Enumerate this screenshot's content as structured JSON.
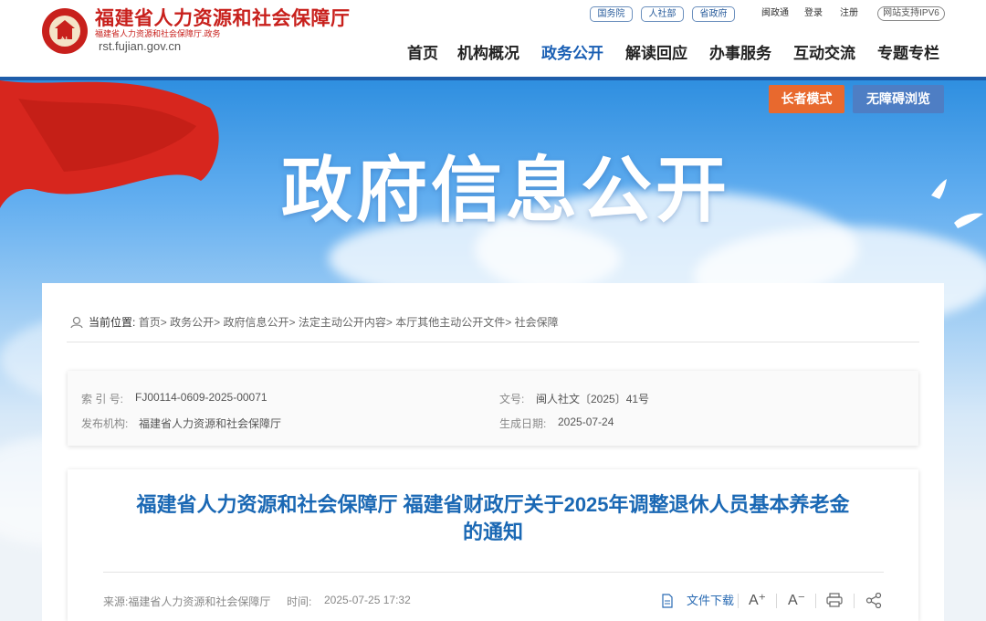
{
  "header": {
    "site_title": "福建省人力资源和社会保障厅",
    "site_subtitle": "福建省人力资源和社会保障厅.政务",
    "domain": "rst.fujian.gov.cn",
    "emblem_glyph": "社",
    "top_pills": [
      "国务院",
      "人社部",
      "省政府"
    ],
    "top_links": [
      "闽政通",
      "登录",
      "注册"
    ],
    "ipv6_badge": "网站支持IPV6",
    "nav": [
      "首页",
      "机构概况",
      "政务公开",
      "解读回应",
      "办事服务",
      "互动交流",
      "专题专栏"
    ],
    "active_nav": "政务公开"
  },
  "banner": {
    "title": "政府信息公开",
    "elder_mode": "长者模式",
    "accessible": "无障碍浏览"
  },
  "breadcrumb": {
    "label": "当前位置:",
    "items": [
      "首页",
      "政务公开",
      "政府信息公开",
      "法定主动公开内容",
      "本厅其他主动公开文件",
      "社会保障"
    ],
    "separator": ">"
  },
  "meta": {
    "index_label": "索 引 号:",
    "index_value": "FJ00114-0609-2025-00071",
    "doc_no_label": "文号:",
    "doc_no_value": "闽人社文〔2025〕41号",
    "publisher_label": "发布机构:",
    "publisher_value": "福建省人力资源和社会保障厅",
    "date_label": "生成日期:",
    "date_value": "2025-07-24"
  },
  "article": {
    "title_line1": "福建省人力资源和社会保障厅 福建省财政厅关于2025年调整退休人员基本养老金",
    "title_line2": "的通知",
    "source": "来源:福建省人力资源和社会保障厅",
    "time_label": "时间:",
    "time_value": "2025-07-25 17:32",
    "download": "文件下载",
    "font_up": "A⁺",
    "font_down": "A⁻"
  },
  "colors": {
    "brand_red": "#c8201c",
    "brand_blue": "#1e5daa",
    "title_blue": "#1a68b4",
    "elder_btn": "#e8692e",
    "access_btn": "#4e7ec4"
  }
}
